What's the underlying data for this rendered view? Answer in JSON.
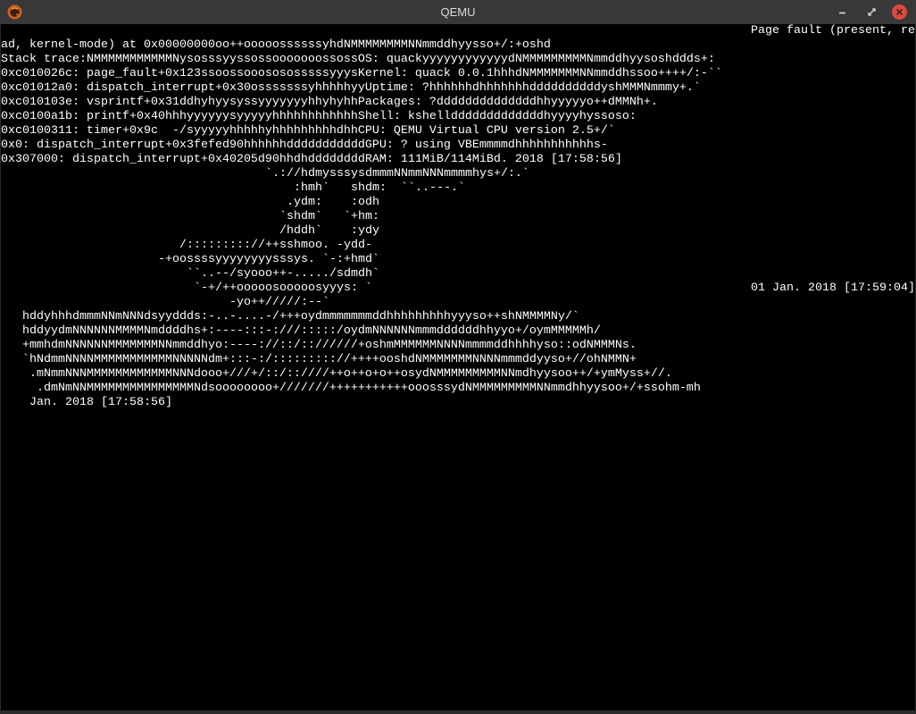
{
  "window": {
    "title": "QEMU"
  },
  "icons": {
    "app": "qemu-logo-icon",
    "minimize": "minimize-icon",
    "maximize": "maximize-icon",
    "close": "close-icon"
  },
  "theme": {
    "titlebar_bg": "#383838",
    "close_button": "#e2473f",
    "console_bg": "#000000",
    "console_fg": "#ffffff"
  },
  "console": {
    "lines": [
      "Page fault (present, re",
      "ad, kernel-mode) at 0x00000000oo++ooooossssssyhdNMMMMMMMMNNmmddhyysso+/:+oshd",
      "Stack trace:NMMMMMMMMMMMNysosssyyssossooooooossossOS: quackyyyyyyyyyyyydNMMMMMMMMMNmmddhyysoshddds+:",
      "0xc010026c: page_fault+0x123ssoossooosososssssyyysKernel: quack 0.0.1hhhdNMMMMMMMNNmmddhssoo++++/:-``",
      "0xc01012a0: dispatch_interrupt+0x30osssssssyhhhhhyyUptime: ?hhhhhhdhhhhhhhddddddddddyshMMMNmmmy+.`",
      "0xc010103e: vsprintf+0x31ddhyhyysyssyyyyyyyhhyhyhhPackages: ?ddddddddddddddhhyyyyyo++dMMNh+.",
      "0xc0100a1b: printf+0x40hhhyyyyyysyyyyyhhhhhhhhhhhhShell: kshelldddddddddddddhyyyyhyssoso:",
      "0xc0100311: timer+0x9c  -/syyyyyhhhhhyhhhhhhhhhdhhCPU: QEMU Virtual CPU version 2.5+/`",
      "0x0: dispatch_interrupt+0x3fefed90hhhhhhdddddddddddGPU: ? using VBEmmmmdhhhhhhhhhhhs-",
      "0x307000: dispatch_interrupt+0x40205d90hhdhddddddddRAM: 111MiB/114MiBd. 2018 [17:58:56]",
      "`.://hdmysssysdmmmNNmmNNNmmmmhys+/:.`",
      ":hmh`   shdm:  ``..---.`",
      ".ydm:    :odh",
      "`shdm`   `+hm:",
      "/hddh`    :ydy",
      "/::::::::://++sshmoo. -ydd-",
      "-+oossssyyyyyyyysssys. `-:+hmd`",
      "``..--/syooo++-...../sdmdh`",
      "`-+/++ooooosooooosyyys: `",
      "01 Jan. 2018 [17:59:04]",
      "-yo++/////:--`",
      "hddyhhhdmmmNNmNNNdsyyddds:-..-....-/+++oydmmmmmmmddhhhhhhhhhyyyso++shNMMMMNy/`",
      "hddyydmNNNNNNMMMMNmddddhs+:----:::-:///:::::/oydmNNNNNNmmmddddddhhyyo+/oymMMMMMh/",
      "+mmhdmNNNNNNMMMMMMMNNmmddhyo:----://::/:://////+oshmMMMMMMNNNNmmmmddhhhhyso::odNMMMNs.",
      "`hNdmmNNNNMMMMMMMMMMMNNNNNdm+:::-:/::::::::://++++ooshdNMMMMMMMNNNNmmmddyyso+//ohNMMN+",
      ".mNmmNNNMMMMMMMMMMMMNNNdooo+///+/::/::////++o++o+o++osydNMMMMMMMMMNNmdhyysoo++/+ymMyss+//.",
      ".dmNmNNMMMMMMMMMMMMMMMNdsoooooooo+///////+++++++++++ooosssydNMMMMMMMMMNNmmdhhyysoo+/+ssohm-mh",
      "Jan. 2018 [17:58:56]"
    ]
  }
}
